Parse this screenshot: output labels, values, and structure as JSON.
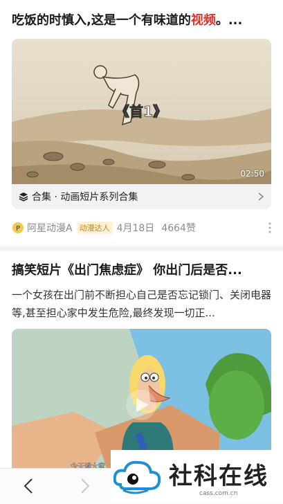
{
  "post1": {
    "title_part1": "吃饭的时慎入,这是一个有味道的",
    "title_highlight": "视频",
    "title_part2": "。...",
    "duration": "02:50",
    "caption": "《首1》",
    "collection_label": "合集 · 动画短片系列合集",
    "author": "阿星动漫A",
    "author_badge": "动漫达人",
    "date": "4月18日",
    "likes": "4664赞"
  },
  "post2": {
    "title": "搞笑短片《出门焦虑症》 你出门后是否...",
    "description": "一个女孩在出门前不断担心自己是否忘记锁门、关闭电器等,甚至担心家中发生危险,最终发现一切正...",
    "subtitle": "今天读大家"
  },
  "watermark": {
    "name": "社科在线",
    "url": "cass.com.cn"
  },
  "colors": {
    "highlight": "#e0302a",
    "badge_text": "#c98218"
  },
  "icons": {
    "collection": "stack-icon",
    "chevron": "chevron-right-icon",
    "more": "more-vertical-icon",
    "back": "back-arrow-icon",
    "forward": "forward-arrow-icon",
    "avatar": "avatar-icon"
  }
}
